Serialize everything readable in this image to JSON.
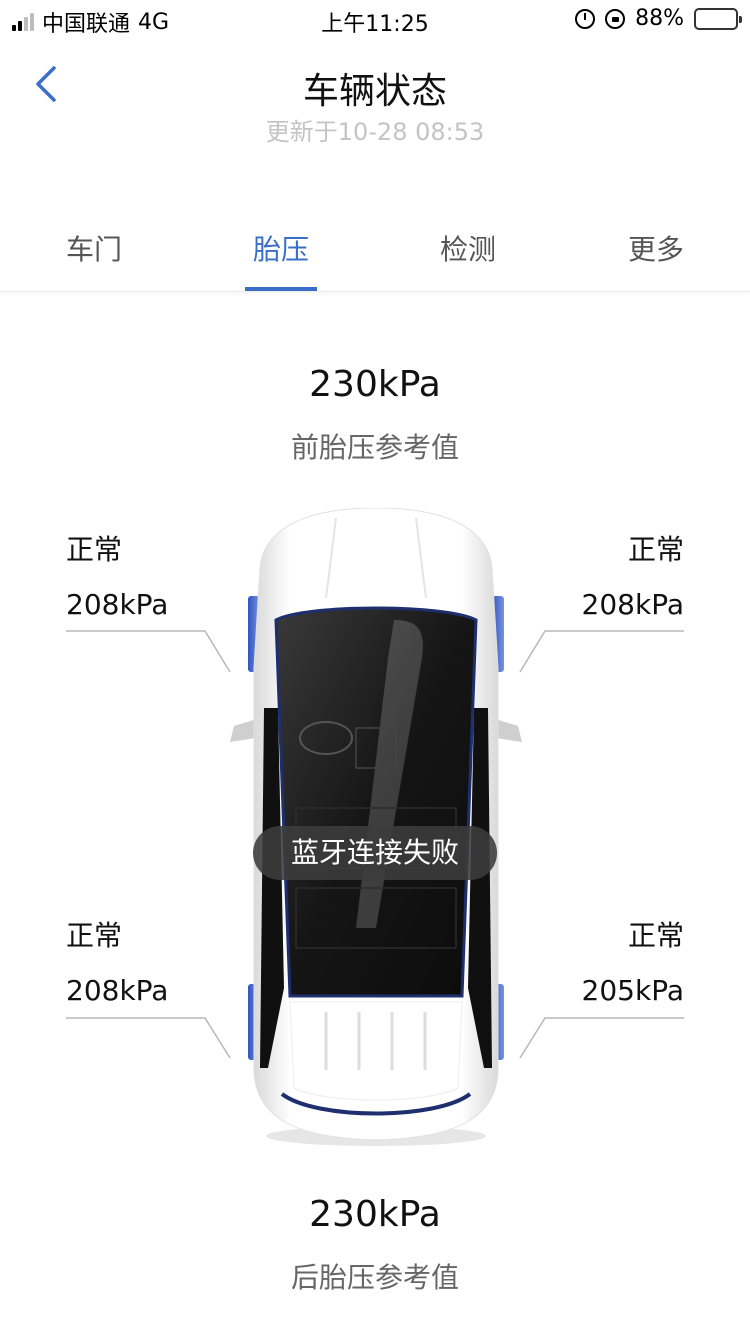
{
  "status_bar": {
    "carrier": "中国联通",
    "network": "4G",
    "time": "上午11:25",
    "battery_percent": "88%",
    "icons": [
      "signal-icon",
      "alarm-icon",
      "rotation-lock-icon",
      "battery-icon"
    ]
  },
  "header": {
    "title": "车辆状态",
    "subtitle": "更新于10-28 08:53",
    "back_icon": "chevron-left-icon"
  },
  "tabs": [
    {
      "label": "车门",
      "active": false
    },
    {
      "label": "胎压",
      "active": true
    },
    {
      "label": "检测",
      "active": false
    },
    {
      "label": "更多",
      "active": false
    }
  ],
  "front_reference": {
    "value": "230kPa",
    "label": "前胎压参考值"
  },
  "rear_reference": {
    "value": "230kPa",
    "label": "后胎压参考值"
  },
  "tires": {
    "front_left": {
      "status": "正常",
      "pressure": "208kPa"
    },
    "front_right": {
      "status": "正常",
      "pressure": "208kPa"
    },
    "rear_left": {
      "status": "正常",
      "pressure": "208kPa"
    },
    "rear_right": {
      "status": "正常",
      "pressure": "205kPa"
    }
  },
  "toast": "蓝牙连接失败",
  "colors": {
    "accent": "#3b6fc7",
    "tire_blue": "#3f63c8",
    "muted_text": "#c4c4c4"
  }
}
